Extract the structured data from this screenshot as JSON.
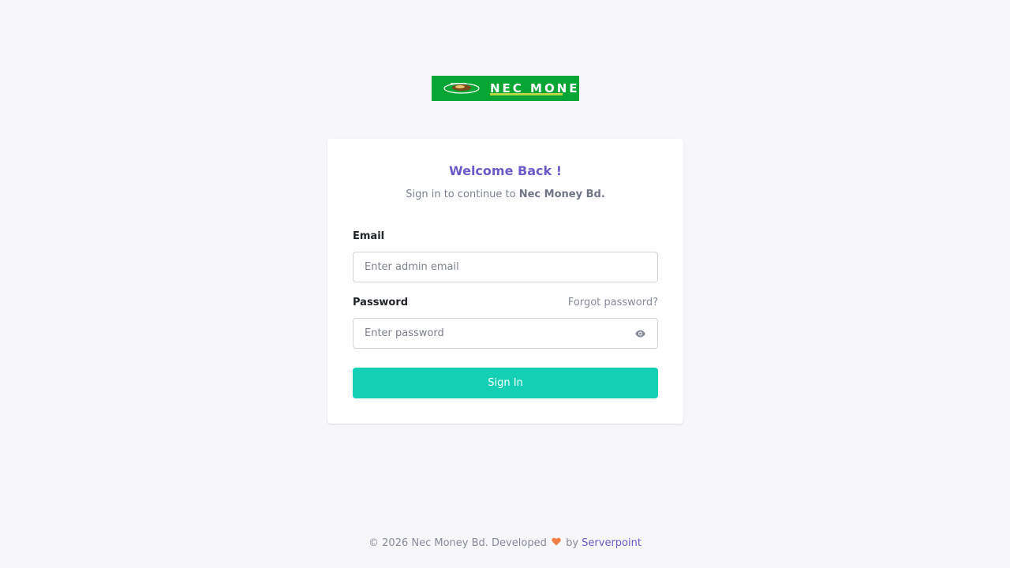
{
  "colors": {
    "background": "#f7f7f9",
    "card": "#ffffff",
    "title": "#6b5ac8",
    "button": "#13d0b4",
    "logo_bg": "#07a534",
    "heart": "#f27d45",
    "link": "#6b5ac8"
  },
  "logo": {
    "text": "NEC MONEY",
    "icon": "coin-hand-icon"
  },
  "card": {
    "title": "Welcome Back !",
    "subtitle_prefix": "Sign in to continue to ",
    "subtitle_brand": "Nec Money Bd."
  },
  "form": {
    "email_label": "Email",
    "email_placeholder": "Enter admin email",
    "email_value": "",
    "password_label": "Password",
    "forgot_label": "Forgot password?",
    "password_placeholder": "Enter password",
    "password_value": "",
    "password_toggle_icon": "eye-icon",
    "submit_label": "Sign In"
  },
  "footer": {
    "prefix": "© 2026 Nec Money Bd. Developed ",
    "heart_icon": "heart-icon",
    "by": " by ",
    "link_text": "Serverpoint"
  }
}
